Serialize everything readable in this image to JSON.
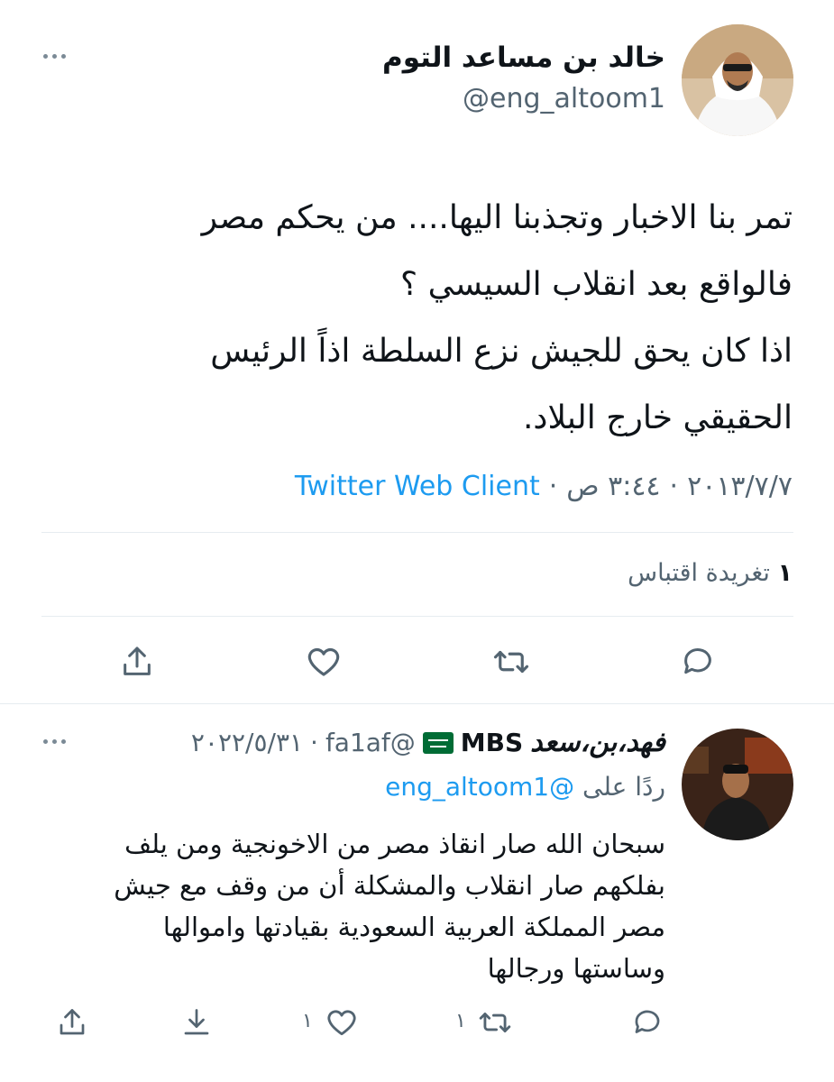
{
  "tweet": {
    "author_name": "خالد بن مساعد التوم",
    "author_handle": "@eng_altoom1",
    "text_lines": [
      "تمر بنا الاخبار وتجذبنا اليها.... من يحكم مصر",
      "فالواقع بعد انقلاب السيسي ؟",
      "اذا كان يحق للجيش نزع السلطة  اذاً الرئيس",
      "الحقيقي خارج البلاد."
    ],
    "date": "٢٠١٣/٧/٧",
    "time": "٣:٤٤ ص",
    "separator": "·",
    "source": "Twitter Web Client",
    "quote_count": "١",
    "quote_label": "تغريدة اقتباس"
  },
  "reply": {
    "author_name": "فهد،بن،سعد",
    "author_suffix": "MBS",
    "flag_icon": "saudi-flag-icon",
    "author_handle": "@fa1af",
    "date": "٢٠٢٢/٥/٣١",
    "separator": "·",
    "replying_prefix": "ردًا على",
    "replying_handle": "@eng_altoom1",
    "text_lines": [
      "سبحان الله صار انقاذ مصر من الاخونجية ومن يلف",
      "بفلكهم صار انقلاب والمشكلة أن من وقف مع جيش",
      "مصر المملكة العربية السعودية بقيادتها واموالها",
      "وساستها ورجالها"
    ],
    "retweet_count": "١",
    "like_count": "١"
  },
  "colors": {
    "link": "#1d9bf0",
    "muted": "#536471",
    "flag_green": "#006c35"
  }
}
